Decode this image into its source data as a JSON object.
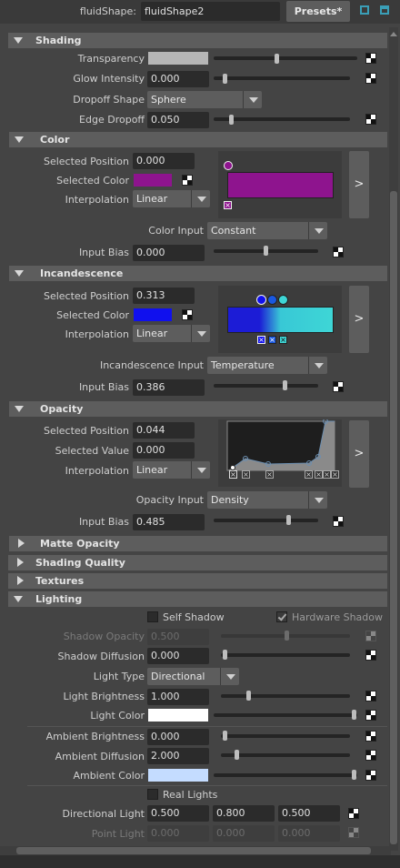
{
  "header": {
    "node_label": "fluidShape:",
    "node_value": "fluidShape2",
    "presets_label": "Presets*"
  },
  "shading": {
    "title": "Shading",
    "transparency_label": "Transparency",
    "transparency_color": "#b6b6b6",
    "glow_label": "Glow Intensity",
    "glow_value": "0.000",
    "dropoff_shape_label": "Dropoff Shape",
    "dropoff_shape_value": "Sphere",
    "edge_dropoff_label": "Edge Dropoff",
    "edge_dropoff_value": "0.050"
  },
  "color": {
    "title": "Color",
    "selected_position_label": "Selected Position",
    "selected_position_value": "0.000",
    "selected_color_label": "Selected Color",
    "selected_color": "#8e148e",
    "interpolation_label": "Interpolation",
    "interpolation_value": "Linear",
    "color_input_label": "Color Input",
    "color_input_value": "Constant",
    "input_bias_label": "Input Bias",
    "input_bias_value": "0.000",
    "expand_label": ">"
  },
  "incandescence": {
    "title": "Incandescence",
    "selected_position_label": "Selected Position",
    "selected_position_value": "0.313",
    "selected_color_label": "Selected Color",
    "selected_color": "#1010ee",
    "interpolation_label": "Interpolation",
    "interpolation_value": "Linear",
    "input_label": "Incandescence Input",
    "input_value": "Temperature",
    "input_bias_label": "Input Bias",
    "input_bias_value": "0.386",
    "expand_label": ">"
  },
  "opacity": {
    "title": "Opacity",
    "selected_position_label": "Selected Position",
    "selected_position_value": "0.044",
    "selected_value_label": "Selected Value",
    "selected_value_value": "0.000",
    "interpolation_label": "Interpolation",
    "interpolation_value": "Linear",
    "input_label": "Opacity Input",
    "input_value": "Density",
    "input_bias_label": "Input Bias",
    "input_bias_value": "0.485",
    "expand_label": ">"
  },
  "collapsed": {
    "matte_opacity": "Matte Opacity",
    "shading_quality": "Shading Quality",
    "textures": "Textures"
  },
  "lighting": {
    "title": "Lighting",
    "self_shadow_label": "Self Shadow",
    "hardware_shadow_label": "Hardware Shadow",
    "shadow_opacity_label": "Shadow Opacity",
    "shadow_opacity_value": "0.500",
    "shadow_diffusion_label": "Shadow Diffusion",
    "shadow_diffusion_value": "0.000",
    "light_type_label": "Light Type",
    "light_type_value": "Directional",
    "light_brightness_label": "Light Brightness",
    "light_brightness_value": "1.000",
    "light_color_label": "Light Color",
    "light_color": "#ffffff",
    "ambient_brightness_label": "Ambient Brightness",
    "ambient_brightness_value": "0.000",
    "ambient_diffusion_label": "Ambient Diffusion",
    "ambient_diffusion_value": "2.000",
    "ambient_color_label": "Ambient Color",
    "ambient_color": "#c4dcff",
    "real_lights_label": "Real Lights",
    "directional_light_label": "Directional Light",
    "directional_light_values": [
      "0.500",
      "0.800",
      "0.500"
    ],
    "point_light_label": "Point Light",
    "point_light_values": [
      "0.000",
      "0.000",
      "0.000"
    ]
  }
}
